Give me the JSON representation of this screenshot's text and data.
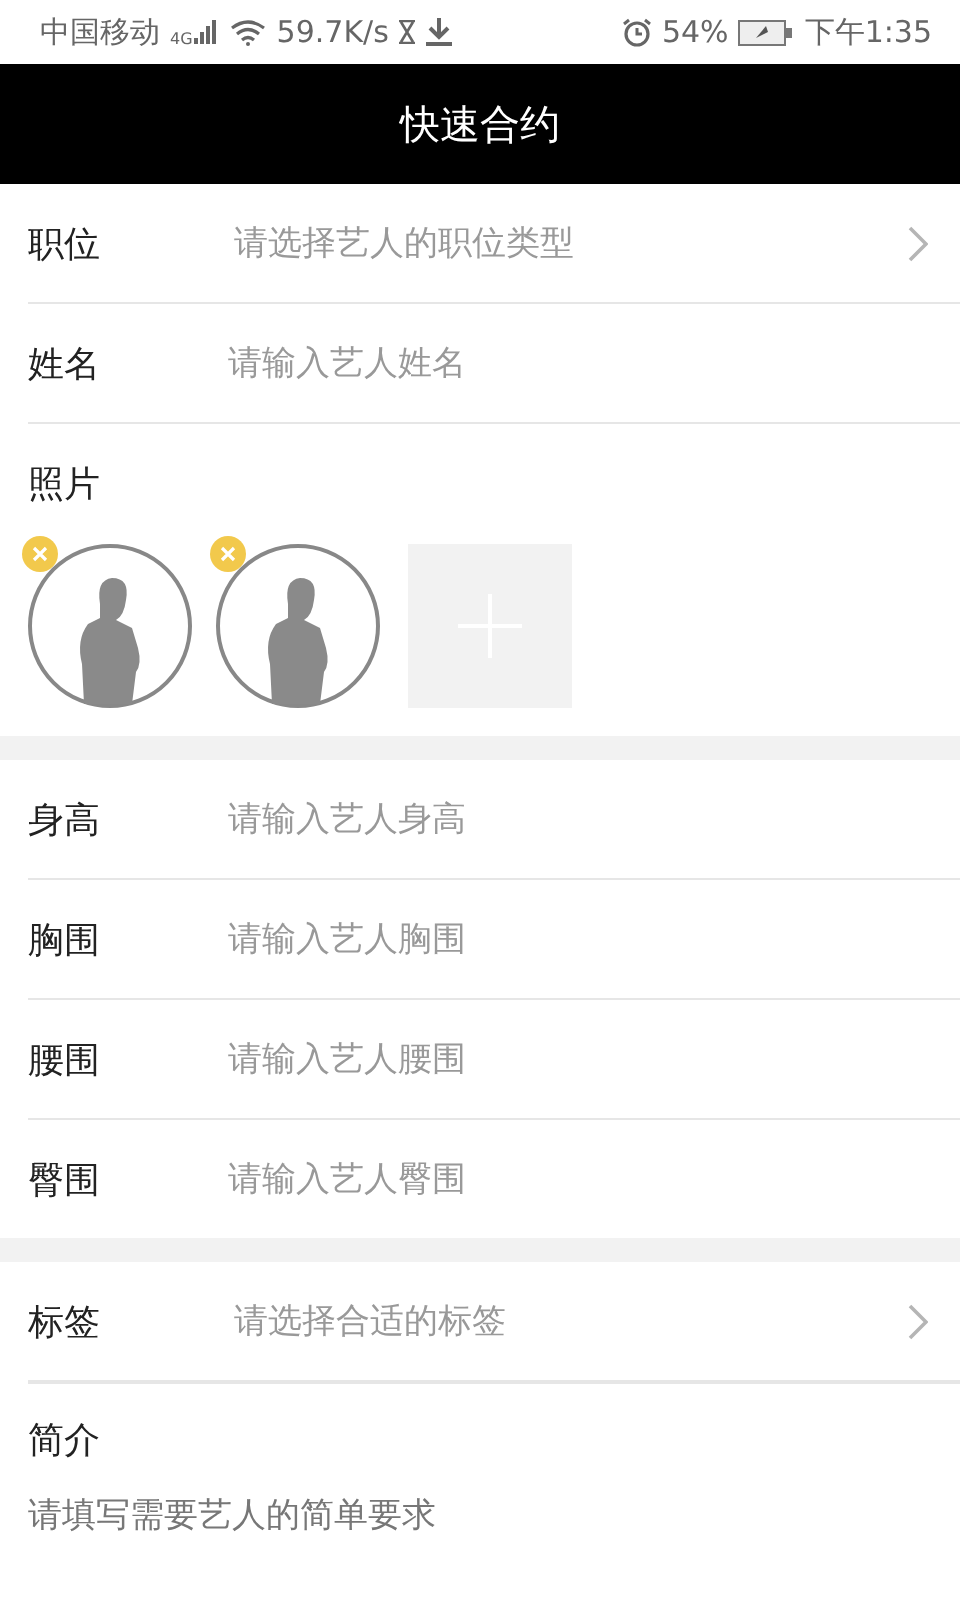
{
  "status_bar": {
    "carrier": "中国移动",
    "network": "4G",
    "speed": "59.7K/s",
    "battery": "54%",
    "time": "下午1:35"
  },
  "header": {
    "title": "快速合约"
  },
  "sections": [
    {
      "rows": [
        {
          "kind": "select",
          "label": "职位",
          "placeholder": "请选择艺人的职位类型"
        },
        {
          "kind": "input",
          "label": "姓名",
          "placeholder": "请输入艺人姓名"
        },
        {
          "kind": "photos",
          "label": "照片",
          "photos": [
            {
              "removable": true
            },
            {
              "removable": true
            }
          ]
        }
      ]
    },
    {
      "rows": [
        {
          "kind": "input",
          "label": "身高",
          "placeholder": "请输入艺人身高"
        },
        {
          "kind": "input",
          "label": "胸围",
          "placeholder": "请输入艺人胸围"
        },
        {
          "kind": "input",
          "label": "腰围",
          "placeholder": "请输入艺人腰围"
        },
        {
          "kind": "input",
          "label": "臀围",
          "placeholder": "请输入艺人臀围"
        }
      ]
    },
    {
      "rows": [
        {
          "kind": "select",
          "label": "标签",
          "placeholder": "请选择合适的标签"
        },
        {
          "kind": "textarea",
          "label": "简介",
          "placeholder": "请填写需要艺人的简单要求"
        }
      ]
    }
  ]
}
